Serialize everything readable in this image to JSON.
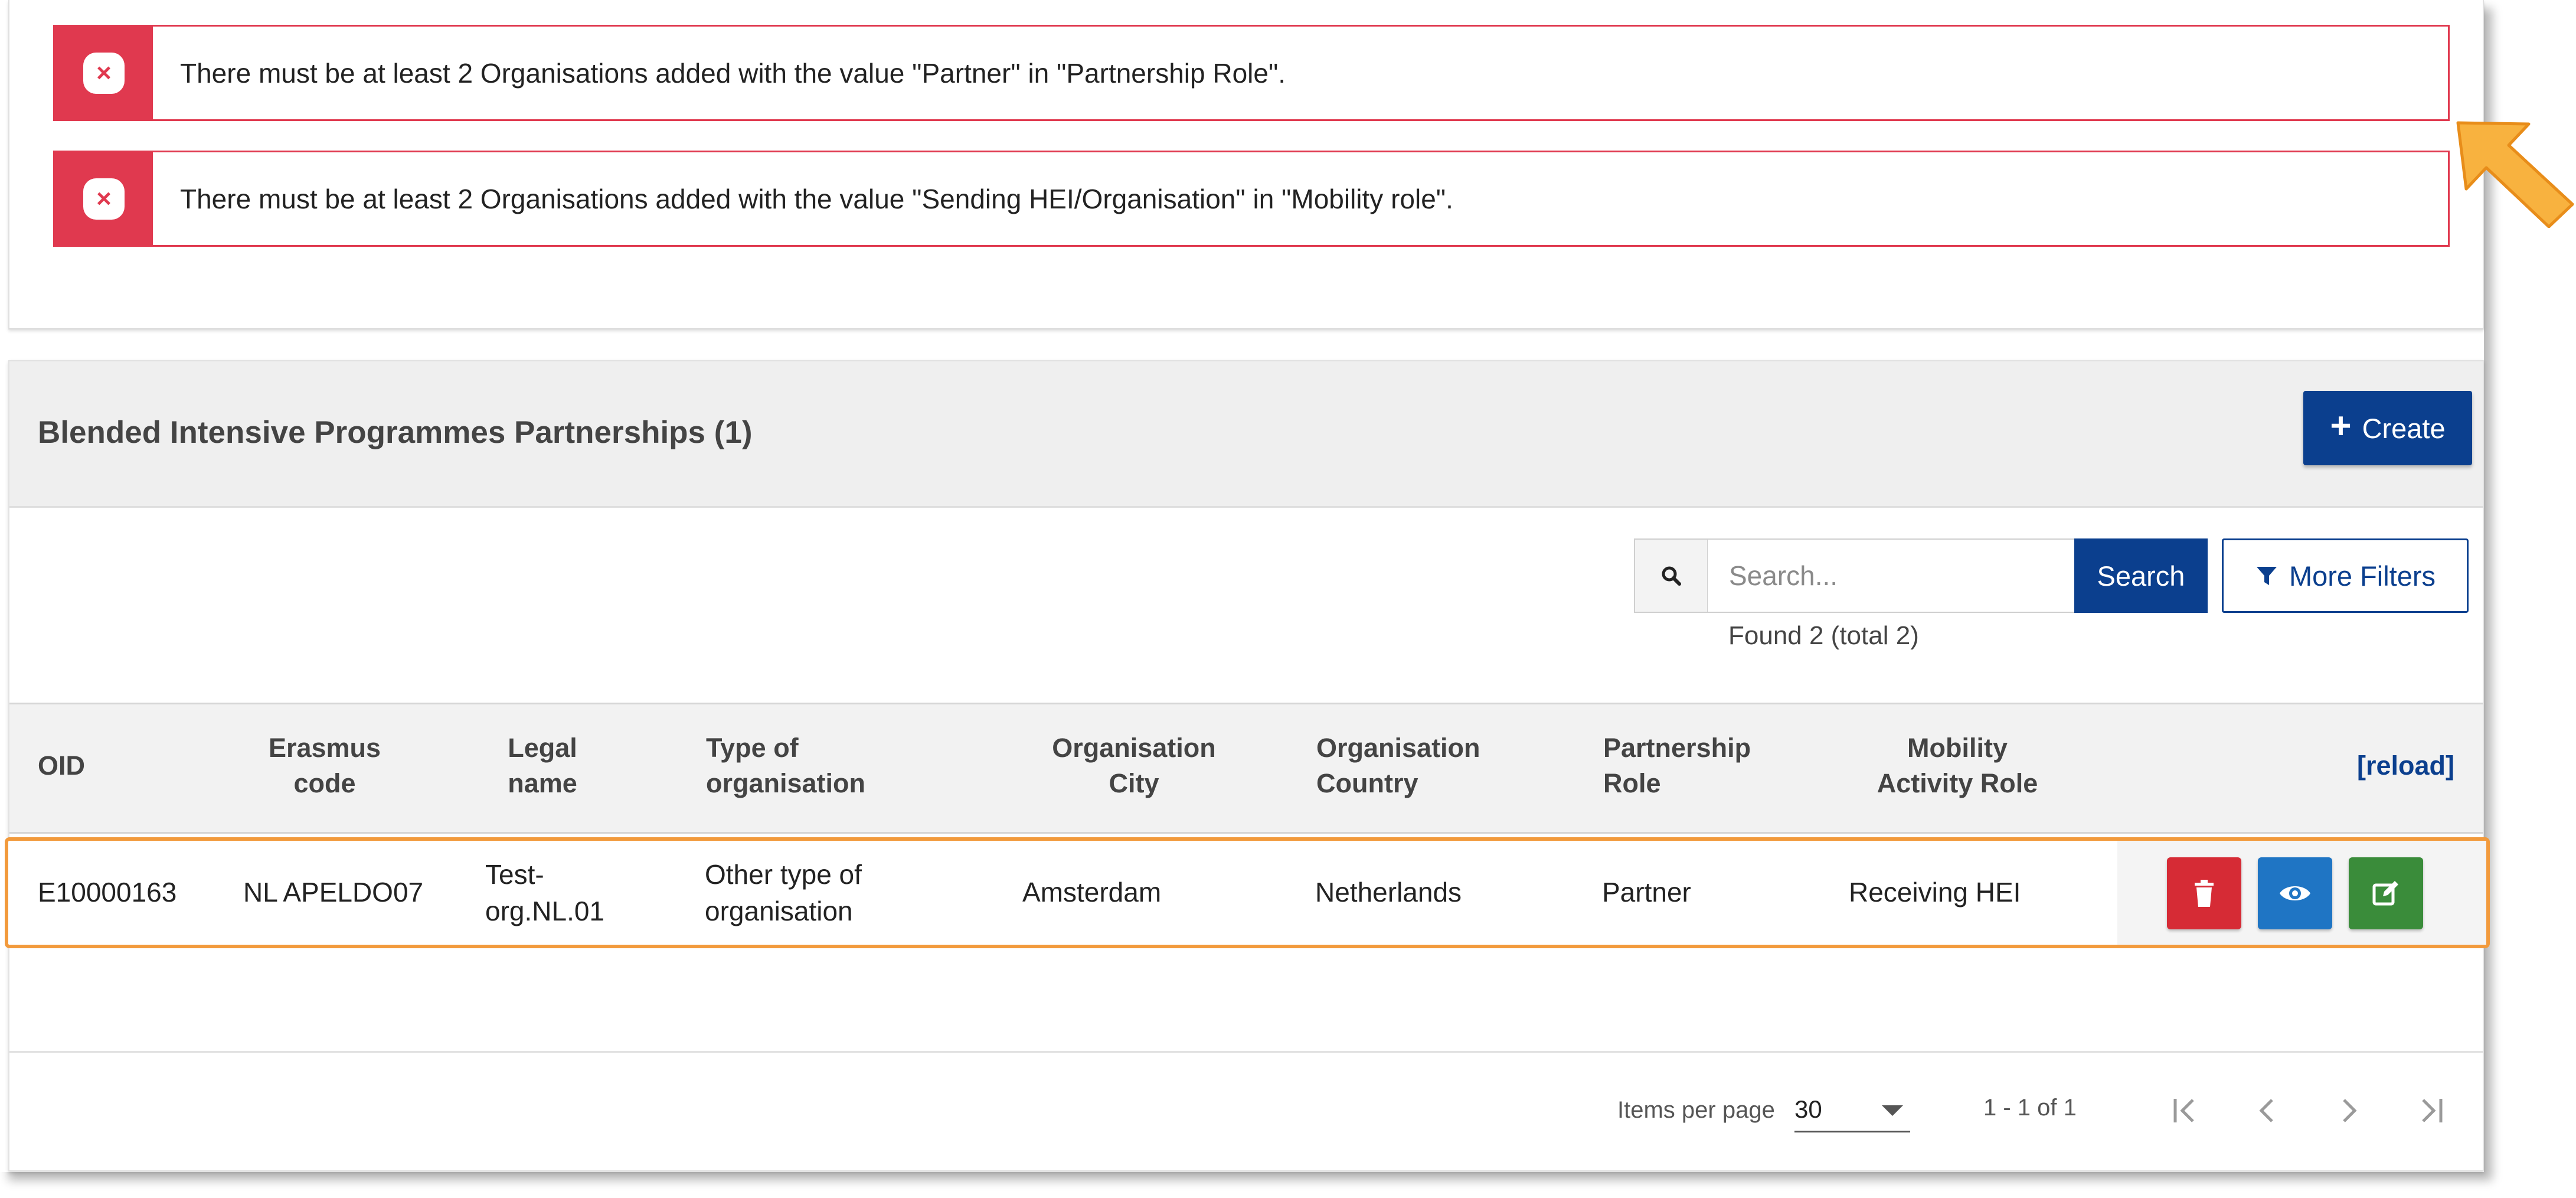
{
  "alerts": [
    {
      "text": "There must be at least 2 Organisations added with the value \"Partner\" in \"Partnership Role\"."
    },
    {
      "text": "There must be at least 2 Organisations added with the value \"Sending HEI/Organisation\" in \"Mobility role\"."
    }
  ],
  "panel": {
    "title": "Blended Intensive Programmes Partnerships (1)",
    "create_label": "Create"
  },
  "search": {
    "placeholder": "Search...",
    "button_label": "Search",
    "filters_label": "More Filters",
    "found_text": "Found 2 (total 2)"
  },
  "table": {
    "headers": {
      "oid": "OID",
      "erasmus_1": "Erasmus",
      "erasmus_2": "code",
      "legal_1": "Legal",
      "legal_2": "name",
      "type_1": "Type of",
      "type_2": "organisation",
      "city_1": "Organisation",
      "city_2": "City",
      "country_1": "Organisation",
      "country_2": "Country",
      "partnership_1": "Partnership",
      "partnership_2": "Role",
      "mobility_1": "Mobility",
      "mobility_2": "Activity Role",
      "reload": "[reload]"
    },
    "rows": [
      {
        "oid": "E10000163",
        "erasmus_code": "NL APELDO07",
        "legal_name_1": "Test-",
        "legal_name_2": "org.NL.01",
        "type_1": "Other type of",
        "type_2": "organisation",
        "city": "Amsterdam",
        "country": "Netherlands",
        "partnership_role": "Partner",
        "mobility_role": "Receiving HEI"
      }
    ]
  },
  "pagination": {
    "items_per_page_label": "Items per page",
    "page_size": "30",
    "range": "1 - 1 of 1"
  },
  "colors": {
    "error": "#e0394f",
    "primary": "#0b3f8e",
    "highlight": "#f29a3c",
    "delete": "#d62b35",
    "view": "#1f75c4",
    "edit": "#3a8c3a"
  }
}
